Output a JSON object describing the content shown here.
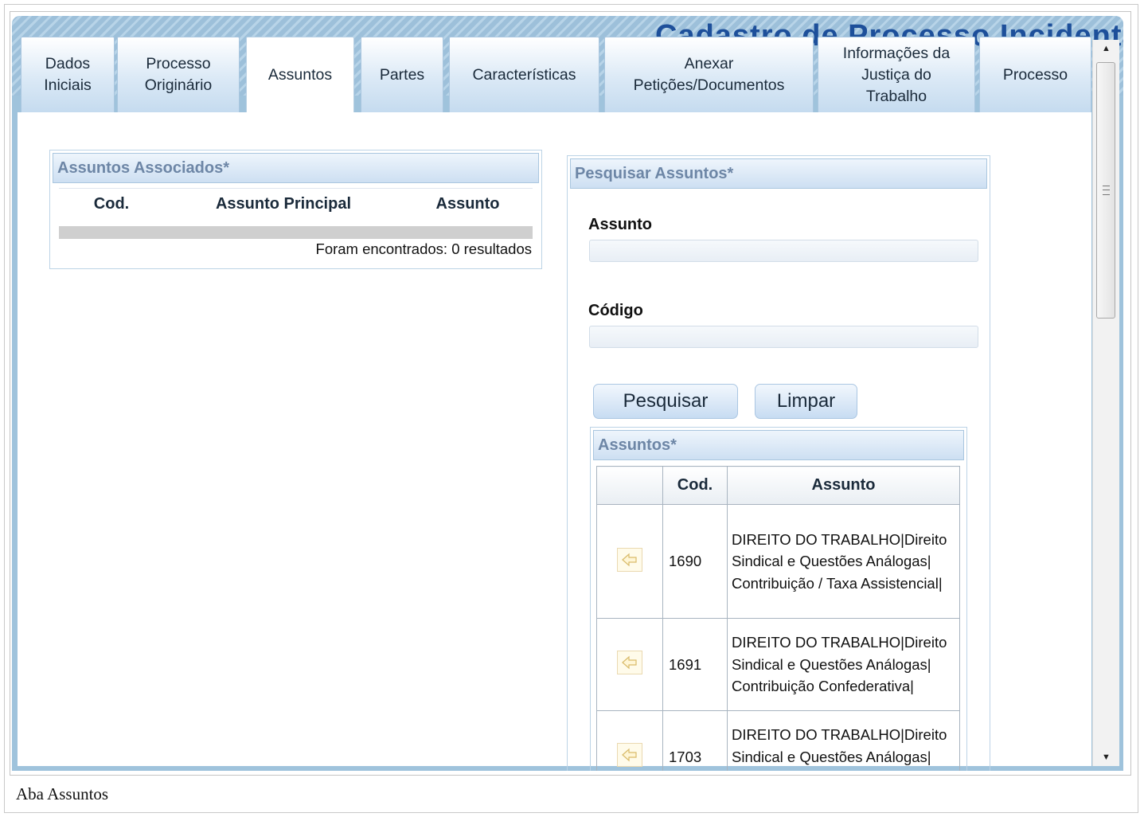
{
  "page": {
    "watermark_title": "Cadastro de Processo Incidental",
    "caption": "Aba Assuntos"
  },
  "tabs": [
    {
      "label": "Dados\nIniciais",
      "active": false
    },
    {
      "label": "Processo\nOriginário",
      "active": false
    },
    {
      "label": "Assuntos",
      "active": true
    },
    {
      "label": "Partes",
      "active": false
    },
    {
      "label": "Características",
      "active": false
    },
    {
      "label": "Anexar\nPetições/Documentos",
      "active": false
    },
    {
      "label": "Informações da\nJustiça do\nTrabalho",
      "active": false
    },
    {
      "label": "Processo",
      "active": false
    }
  ],
  "associated": {
    "title": "Assuntos Associados*",
    "columns": [
      "Cod.",
      "Assunto Principal",
      "Assunto"
    ],
    "count_text": "Foram encontrados: 0 resultados"
  },
  "search": {
    "title": "Pesquisar Assuntos*",
    "assunto_label": "Assunto",
    "assunto_value": "",
    "codigo_label": "Código",
    "codigo_value": "",
    "search_button": "Pesquisar",
    "clear_button": "Limpar"
  },
  "results": {
    "title": "Assuntos*",
    "columns": [
      "",
      "Cod.",
      "Assunto"
    ],
    "rows": [
      {
        "cod": "1690",
        "assunto": "DIREITO DO TRABALHO|Direito Sindical e Questões Análogas| Contribuição / Taxa Assistencial|"
      },
      {
        "cod": "1691",
        "assunto": "DIREITO DO TRABALHO|Direito Sindical e Questões Análogas| Contribuição Confederativa|"
      },
      {
        "cod": "1703",
        "assunto": "DIREITO DO TRABALHO|Direito Sindical e Questões Análogas| Eleição|"
      }
    ],
    "row_icon": "add-arrow-icon"
  },
  "colors": {
    "frame_blue": "#9fc3dc",
    "title_blue": "#1d4f9a",
    "panel_header_text": "#6d86a6"
  }
}
